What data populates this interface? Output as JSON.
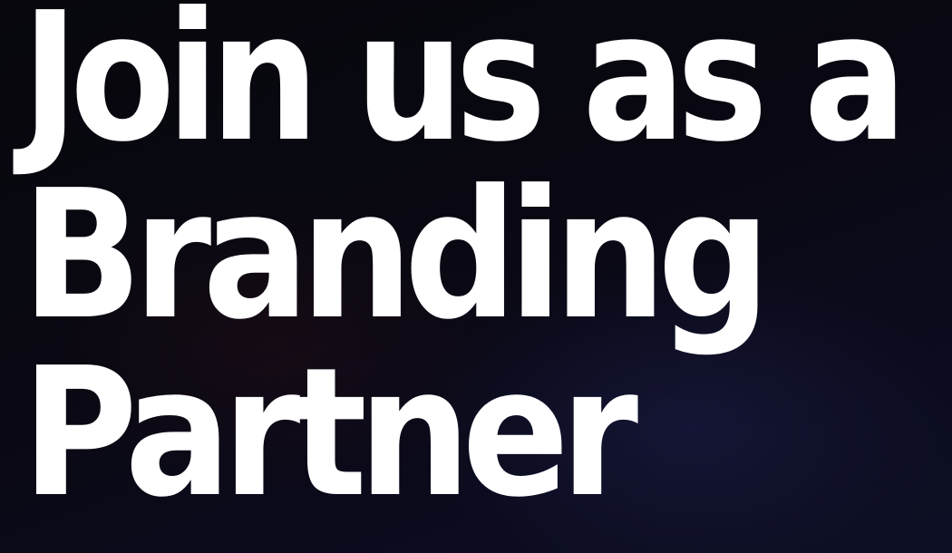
{
  "hero": {
    "headline_lines": [
      "Join us as a",
      "Branding",
      "Partner"
    ]
  },
  "colors": {
    "background": "#07070d",
    "text": "#ffffff"
  }
}
